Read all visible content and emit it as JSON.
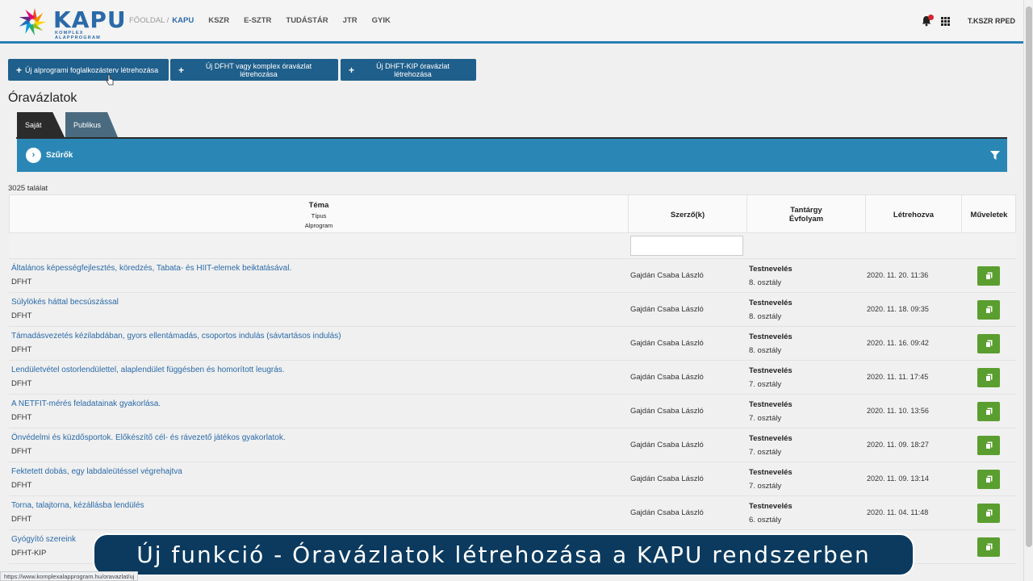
{
  "header": {
    "logo_text": "KAPU",
    "logo_sub": "KOMPLEX ALAPPROGRAM",
    "nav": {
      "crumb": "FŐOLDAL /",
      "active": "KAPU",
      "items": [
        "KSZR",
        "E-SZTR",
        "TUDÁSTÁR",
        "JTR",
        "GYIK"
      ]
    },
    "user": "T.KSZR RPED"
  },
  "actions": {
    "btn1": "Új alprogrami foglalkozásterv létrehozása",
    "btn2": "Új DFHT vagy komplex óravázlat létrehozása",
    "btn3": "Új DHFT-KIP óravázlat létrehozása"
  },
  "page_title": "Óravázlatok",
  "tabs": {
    "own": "Saját",
    "public": "Publikus"
  },
  "filters": {
    "label": "Szűrők"
  },
  "result_count": "3025 találat",
  "table": {
    "headers": {
      "topic": "Téma",
      "type": "Típus",
      "subprogram": "Alprogram",
      "authors": "Szerző(k)",
      "subject": "Tantárgy",
      "grade": "Évfolyam",
      "created": "Létrehozva",
      "actions": "Műveletek"
    },
    "rows": [
      {
        "title": "Általános képességfejlesztés, köredzés, Tabata- és HIIT-elemek beiktatásával.",
        "type": "DFHT",
        "author": "Gajdán Csaba László",
        "subject": "Testnevelés",
        "grade": "8. osztály",
        "date": "2020. 11. 20. 11:36"
      },
      {
        "title": "Súlylökés háttal becsúszással",
        "type": "DFHT",
        "author": "Gajdán Csaba László",
        "subject": "Testnevelés",
        "grade": "8. osztály",
        "date": "2020. 11. 18. 09:35"
      },
      {
        "title": "Támadásvezetés kézilabdában, gyors ellentámadás, csoportos indulás (sávtartásos indulás)",
        "type": "DFHT",
        "author": "Gajdán Csaba László",
        "subject": "Testnevelés",
        "grade": "8. osztály",
        "date": "2020. 11. 16. 09:42"
      },
      {
        "title": "Lendületvétel ostorlendülettel, alaplendület függésben és homorított leugrás.",
        "type": "DFHT",
        "author": "Gajdán Csaba László",
        "subject": "Testnevelés",
        "grade": "7. osztály",
        "date": "2020. 11. 11. 17:45"
      },
      {
        "title": "A NETFIT-mérés feladatainak gyakorlása.",
        "type": "DFHT",
        "author": "Gajdán Csaba László",
        "subject": "Testnevelés",
        "grade": "7. osztály",
        "date": "2020. 11. 10. 13:56"
      },
      {
        "title": "Önvédelmi és küzdősportok. Előkészítő cél- és rávezető játékos gyakorlatok.",
        "type": "DFHT",
        "author": "Gajdán Csaba László",
        "subject": "Testnevelés",
        "grade": "7. osztály",
        "date": "2020. 11. 09. 18:27"
      },
      {
        "title": "Fektetett dobás, egy labdaleütéssel végrehajtva",
        "type": "DFHT",
        "author": "Gajdán Csaba László",
        "subject": "Testnevelés",
        "grade": "7. osztály",
        "date": "2020. 11. 09. 13:14"
      },
      {
        "title": "Torna, talajtorna, kézállásba lendülés",
        "type": "DFHT",
        "author": "Gajdán Csaba László",
        "subject": "Testnevelés",
        "grade": "6. osztály",
        "date": "2020. 11. 04. 11:48"
      },
      {
        "title": "Gyógyító szereink",
        "type": "DFHT-KIP",
        "author": "",
        "subject": "",
        "grade": "",
        "date": "20:44"
      }
    ]
  },
  "caption": "Új funkció  - Óravázlatok létrehozása a KAPU rendszerben",
  "status_url": "https://www.komplexalapprogram.hu/oravazlat/uj",
  "colors": {
    "accent": "#2a87b5",
    "button": "#1f5f8b",
    "copy_button": "#5a9e2f",
    "link": "#2a6aa8"
  }
}
